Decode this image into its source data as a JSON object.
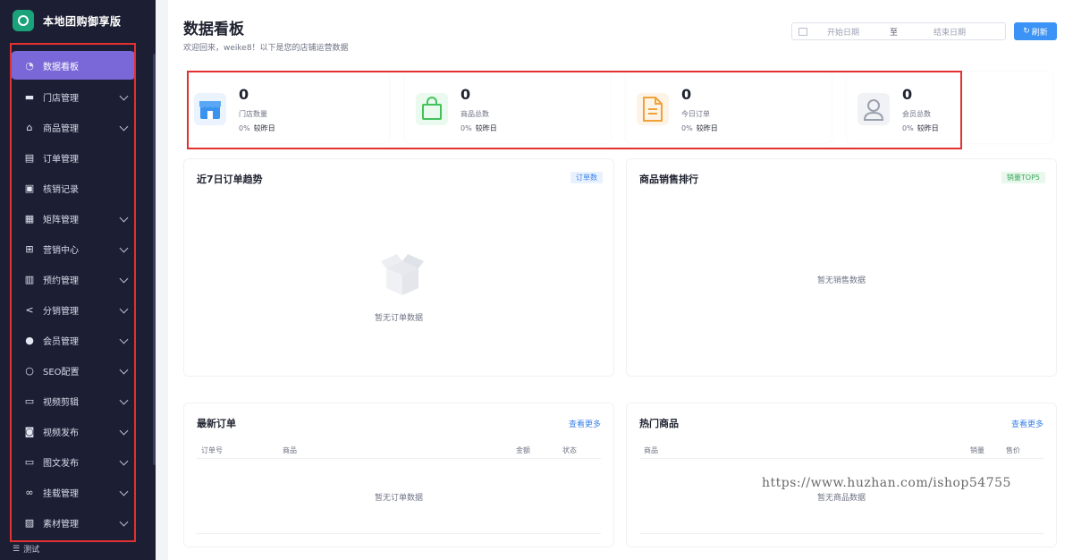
{
  "sidebar": {
    "brand": "本地团购御享版",
    "items": [
      {
        "label": "数据看板",
        "icon": "dashboard-icon",
        "active": true,
        "expandable": false
      },
      {
        "label": "门店管理",
        "icon": "store-icon",
        "active": false,
        "expandable": true
      },
      {
        "label": "商品管理",
        "icon": "bag-icon",
        "active": false,
        "expandable": true
      },
      {
        "label": "订单管理",
        "icon": "document-icon",
        "active": false,
        "expandable": false
      },
      {
        "label": "核销记录",
        "icon": "clipboard-check-icon",
        "active": false,
        "expandable": false
      },
      {
        "label": "矩阵管理",
        "icon": "grid-icon",
        "active": false,
        "expandable": true
      },
      {
        "label": "营销中心",
        "icon": "gift-icon",
        "active": false,
        "expandable": true
      },
      {
        "label": "预约管理",
        "icon": "calendar-icon",
        "active": false,
        "expandable": true
      },
      {
        "label": "分销管理",
        "icon": "share-icon",
        "active": false,
        "expandable": true
      },
      {
        "label": "会员管理",
        "icon": "user-icon",
        "active": false,
        "expandable": true
      },
      {
        "label": "SEO配置",
        "icon": "search-icon",
        "active": false,
        "expandable": true
      },
      {
        "label": "视频剪辑",
        "icon": "video-icon",
        "active": false,
        "expandable": true
      },
      {
        "label": "视频发布",
        "icon": "camera-icon",
        "active": false,
        "expandable": true
      },
      {
        "label": "图文发布",
        "icon": "image-text-icon",
        "active": false,
        "expandable": true
      },
      {
        "label": "挂载管理",
        "icon": "link-icon",
        "active": false,
        "expandable": true
      },
      {
        "label": "素材管理",
        "icon": "picture-icon",
        "active": false,
        "expandable": true
      }
    ],
    "footer": "测试"
  },
  "header": {
    "title": "数据看板",
    "subtitle": "欢迎回来，weike8！以下是您的店铺运营数据",
    "date_start_placeholder": "开始日期",
    "date_separator": "至",
    "date_end_placeholder": "结束日期",
    "refresh_label": "刷新"
  },
  "stats": [
    {
      "value": "0",
      "label": "门店数量",
      "change": "0%",
      "compare": "较昨日",
      "icon": "store-icon",
      "color": "#3b93f0"
    },
    {
      "value": "0",
      "label": "商品总数",
      "change": "0%",
      "compare": "较昨日",
      "icon": "shopping-bag-icon",
      "color": "#43c15a"
    },
    {
      "value": "0",
      "label": "今日订单",
      "change": "0%",
      "compare": "较昨日",
      "icon": "order-document-icon",
      "color": "#f0a23a"
    },
    {
      "value": "0",
      "label": "会员总数",
      "change": "0%",
      "compare": "较昨日",
      "icon": "member-icon",
      "color": "#9aa0ad"
    }
  ],
  "panels": {
    "trend": {
      "title": "近7日订单趋势",
      "tag": "订单数",
      "empty": "暂无订单数据"
    },
    "ranking": {
      "title": "商品销售排行",
      "tag": "销量TOP5",
      "empty": "暂无销售数据"
    },
    "latest_orders": {
      "title": "最新订单",
      "more": "查看更多",
      "columns": [
        "订单号",
        "商品",
        "金额",
        "状态"
      ],
      "empty": "暂无订单数据"
    },
    "hot_products": {
      "title": "热门商品",
      "more": "查看更多",
      "columns": [
        "商品",
        "销量",
        "售价"
      ],
      "empty": "暂无商品数据"
    }
  },
  "watermark": "https://www.huzhan.com/ishop54755",
  "colors": {
    "sidebar_bg": "#1c1f33",
    "active_item": "#7a68d8",
    "primary": "#3a93f5",
    "highlight_border": "#e33030"
  }
}
